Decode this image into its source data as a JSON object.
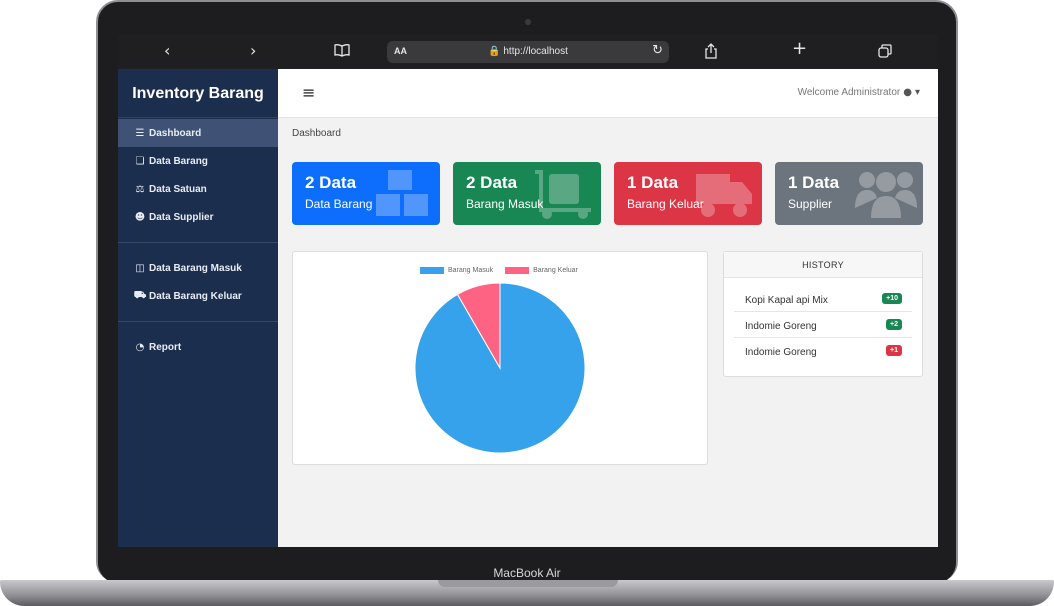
{
  "device": {
    "label": "MacBook Air"
  },
  "browser": {
    "back_icon": "chevron-left-icon",
    "forward_icon": "chevron-right-icon",
    "reader_mode": "AA",
    "url": "http://localhost"
  },
  "sidebar": {
    "brand": "Inventory Barang",
    "items": [
      {
        "label": "Dashboard",
        "icon": "list-icon",
        "active": true
      },
      {
        "label": "Data Barang",
        "icon": "boxes-icon"
      },
      {
        "label": "Data Satuan",
        "icon": "scale-icon"
      },
      {
        "label": "Data Supplier",
        "icon": "users-icon"
      },
      {
        "label": "Data Barang Masuk",
        "icon": "dolly-icon"
      },
      {
        "label": "Data Barang Keluar",
        "icon": "truck-icon"
      },
      {
        "label": "Report",
        "icon": "pie-chart-icon"
      }
    ]
  },
  "topbar": {
    "welcome": "Welcome Administrator"
  },
  "breadcrumb": "Dashboard",
  "cards": [
    {
      "count": "2 Data",
      "label": "Data Barang",
      "color": "#0d6efd",
      "icon": "boxes-icon"
    },
    {
      "count": "2 Data",
      "label": "Barang Masuk",
      "color": "#198754",
      "icon": "dolly-icon"
    },
    {
      "count": "1 Data",
      "label": "Barang Keluar",
      "color": "#dc3545",
      "icon": "truck-icon"
    },
    {
      "count": "1 Data",
      "label": "Supplier",
      "color": "#6c757d",
      "icon": "users-icon"
    }
  ],
  "chart_data": {
    "type": "pie",
    "categories": [
      "Barang Masuk",
      "Barang Keluar"
    ],
    "values": [
      11,
      1
    ],
    "colors": [
      "#36a2eb",
      "#ff6384"
    ],
    "legend_position": "top"
  },
  "history": {
    "title": "HISTORY",
    "items": [
      {
        "name": "Kopi Kapal api Mix",
        "badge": "+10",
        "color": "#198754"
      },
      {
        "name": "Indomie Goreng",
        "badge": "+2",
        "color": "#198754"
      },
      {
        "name": "Indomie Goreng",
        "badge": "+1",
        "color": "#dc3545"
      }
    ]
  }
}
